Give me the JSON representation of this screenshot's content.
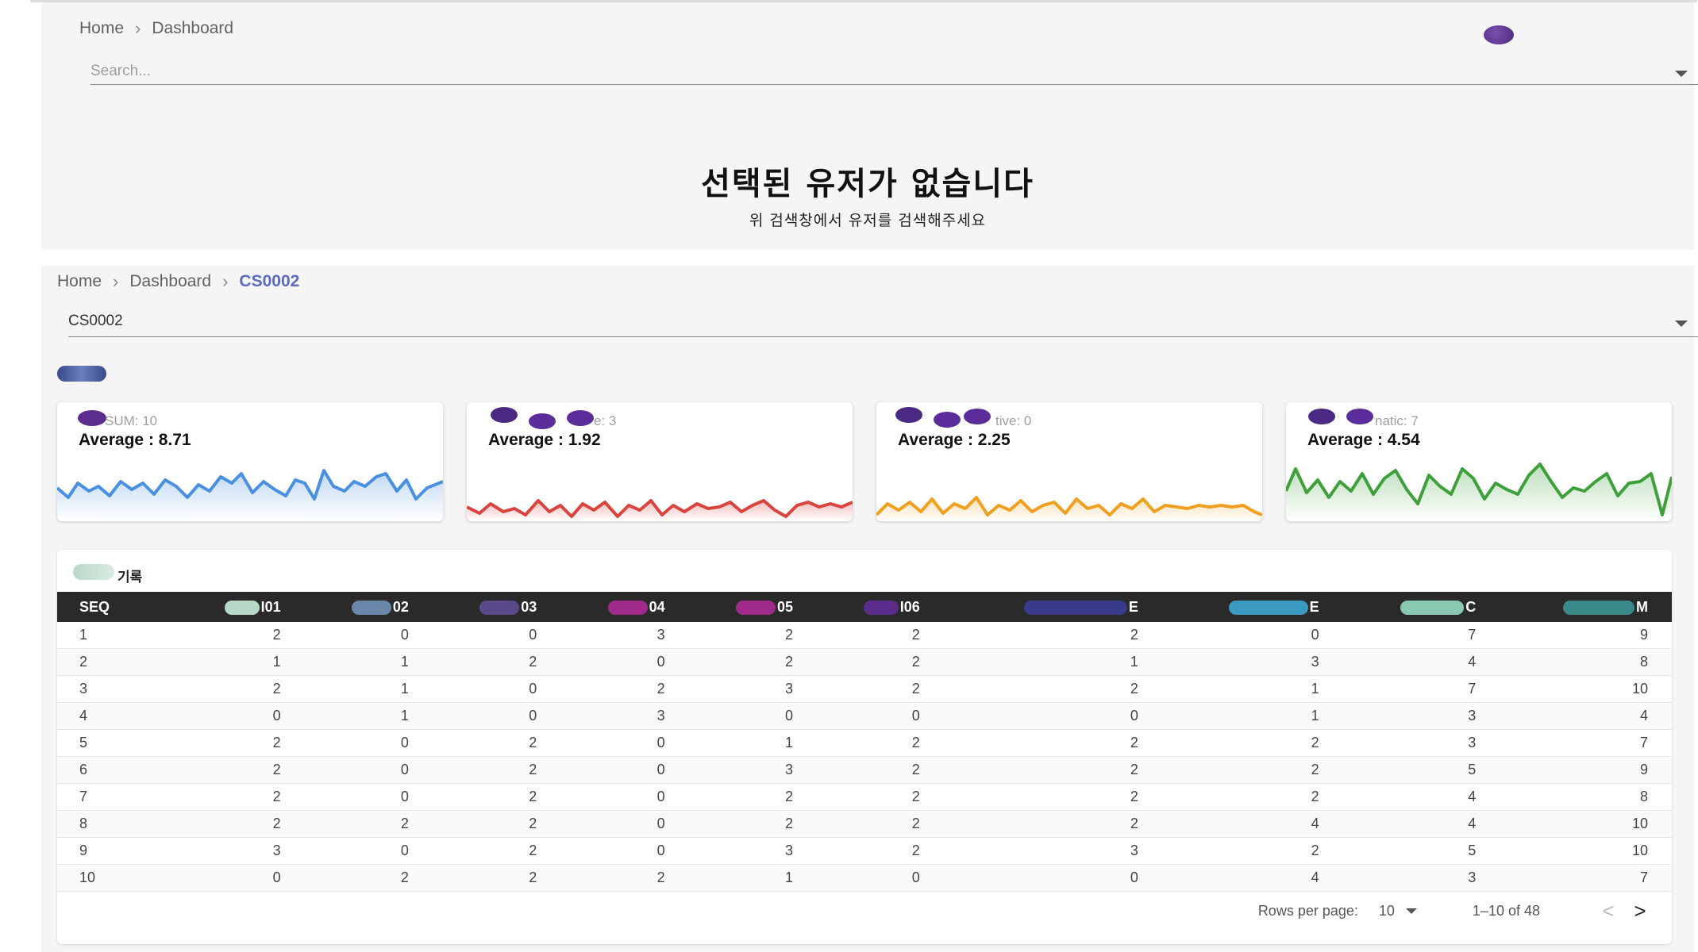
{
  "panel1": {
    "breadcrumb": [
      "Home",
      "Dashboard"
    ],
    "search": {
      "placeholder": "Search..."
    },
    "empty": {
      "title": "선택된 유저가 없습니다",
      "subtitle": "위 검색창에서 유저를 검색해주세요"
    }
  },
  "panel2": {
    "breadcrumb": [
      "Home",
      "Dashboard",
      "CS0002"
    ],
    "selector": {
      "value": "CS0002"
    },
    "cards": [
      {
        "label": "SUM: 10",
        "average": "Average : 8.71",
        "color": "#4a90e2"
      },
      {
        "label": "e: 3",
        "average": "Average : 1.92",
        "color": "#d9443f"
      },
      {
        "label": "tive: 0",
        "average": "Average : 2.25",
        "color": "#f0a020"
      },
      {
        "label": "natic: 7",
        "average": "Average : 4.54",
        "color": "#3ea03a"
      }
    ],
    "table": {
      "title": "기록",
      "headers": [
        "SEQ",
        "I01",
        "02",
        "03",
        "04",
        "05",
        "I06",
        "E",
        "E",
        "C",
        "M"
      ],
      "rows": [
        [
          "1",
          "2",
          "0",
          "0",
          "3",
          "2",
          "2",
          "2",
          "0",
          "7",
          "9"
        ],
        [
          "2",
          "1",
          "1",
          "2",
          "0",
          "2",
          "2",
          "1",
          "3",
          "4",
          "8"
        ],
        [
          "3",
          "2",
          "1",
          "0",
          "2",
          "3",
          "2",
          "2",
          "1",
          "7",
          "10"
        ],
        [
          "4",
          "0",
          "1",
          "0",
          "3",
          "0",
          "0",
          "0",
          "1",
          "3",
          "4"
        ],
        [
          "5",
          "2",
          "0",
          "2",
          "0",
          "1",
          "2",
          "2",
          "2",
          "3",
          "7"
        ],
        [
          "6",
          "2",
          "0",
          "2",
          "0",
          "3",
          "2",
          "2",
          "2",
          "5",
          "9"
        ],
        [
          "7",
          "2",
          "0",
          "2",
          "0",
          "2",
          "2",
          "2",
          "2",
          "4",
          "8"
        ],
        [
          "8",
          "2",
          "2",
          "2",
          "0",
          "2",
          "2",
          "2",
          "4",
          "4",
          "10"
        ],
        [
          "9",
          "3",
          "0",
          "2",
          "0",
          "3",
          "2",
          "3",
          "2",
          "5",
          "10"
        ],
        [
          "10",
          "0",
          "2",
          "2",
          "2",
          "1",
          "0",
          "0",
          "4",
          "3",
          "7"
        ]
      ]
    },
    "pagination": {
      "rows_per_page_label": "Rows per page:",
      "rows_per_page": "10",
      "range": "1–10 of 48",
      "prev": "<",
      "next": ">"
    }
  }
}
